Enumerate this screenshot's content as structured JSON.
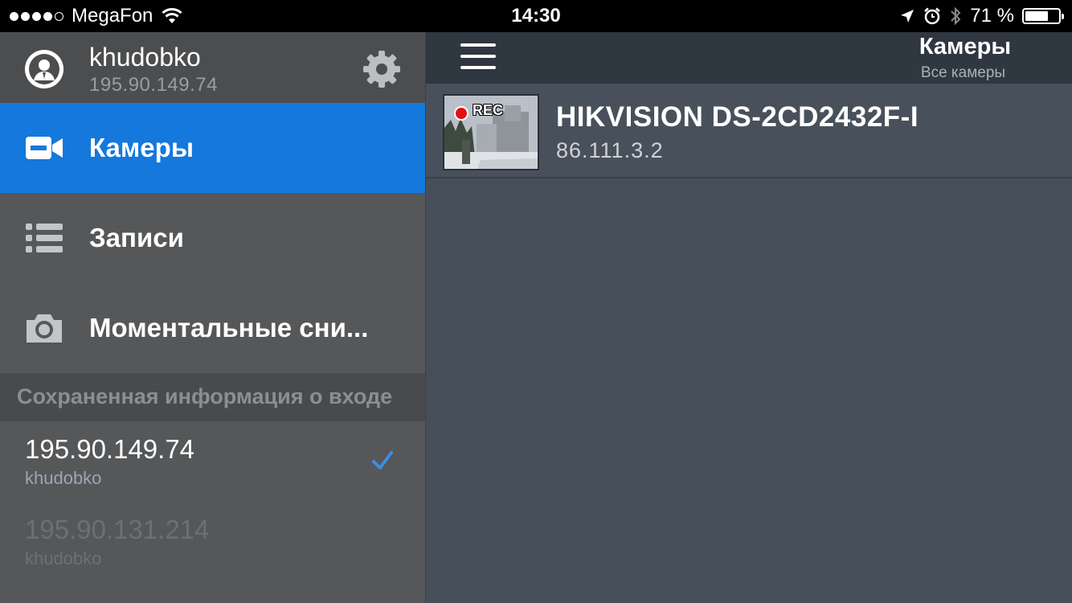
{
  "status_bar": {
    "carrier": "MegaFon",
    "time": "14:30",
    "battery": "71 %",
    "battery_level": 0.71,
    "icons": [
      "signal-dots-icon",
      "wifi-icon",
      "location-arrow-icon",
      "alarm-icon",
      "bluetooth-icon",
      "battery-icon"
    ]
  },
  "sidebar": {
    "profile": {
      "username": "khudobko",
      "ip": "195.90.149.74",
      "icons": [
        "user-avatar-icon",
        "gear-icon"
      ]
    },
    "nav": [
      {
        "label": "Камеры",
        "icon": "video-camera-icon",
        "active": true
      },
      {
        "label": "Записи",
        "icon": "list-icon",
        "active": false
      },
      {
        "label": "Моментальные сни...",
        "icon": "photo-camera-icon",
        "active": false
      }
    ],
    "saved_header": "Сохраненная информация о входе",
    "logins": [
      {
        "ip": "195.90.149.74",
        "user": "khudobko",
        "selected": true
      },
      {
        "ip": "195.90.131.214",
        "user": "khudobko",
        "selected": false
      }
    ]
  },
  "main": {
    "title": "Камеры",
    "subtitle": "Все камеры",
    "cameras": [
      {
        "name": "HIKVISION DS-2CD2432F-I",
        "ip": "86.111.3.2",
        "rec_label": "REC"
      }
    ]
  },
  "colors": {
    "active": "#1478dc",
    "sidebar_bg": "#555759",
    "main_bg": "#464f59",
    "topbar_bg": "#2f3741",
    "check": "#3a8fe0",
    "rec": "#e01010"
  }
}
